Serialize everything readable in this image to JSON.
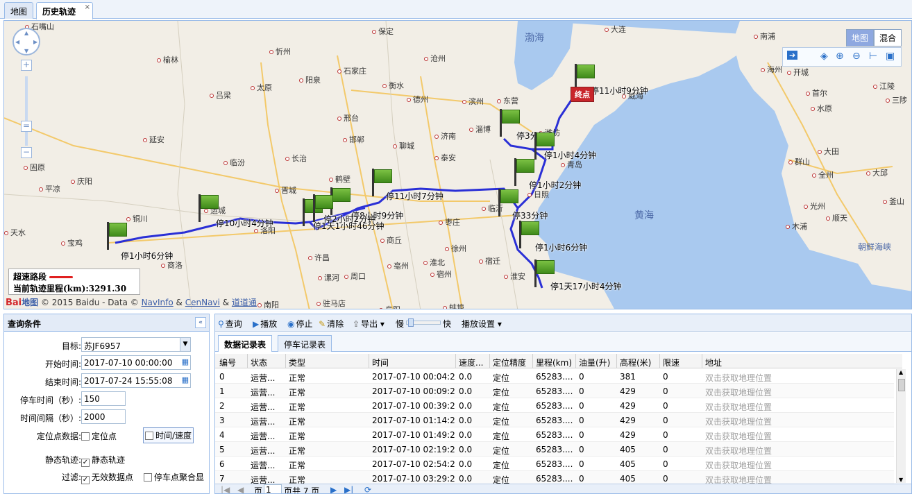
{
  "tabs": [
    {
      "label": "地图"
    },
    {
      "label": "历史轨迹"
    }
  ],
  "tab_close": "×",
  "map": {
    "type_buttons": {
      "map": "地图",
      "hybrid": "混合"
    },
    "legend": {
      "overspeed": "超速路段",
      "mileage": "当前轨迹里程(km):3291.30"
    },
    "copyright": {
      "logo": "Bai",
      "logo2": "地图",
      "text": "© 2015 Baidu - Data ©",
      "navinfo": "NavInfo",
      "amp": "&",
      "cennavi": "CenNavi",
      "amp2": "&",
      "daodao": "道道通"
    },
    "sea_labels": [
      {
        "t": "渤海"
      },
      {
        "t": "黄海"
      },
      {
        "t": "朝鲜海峡"
      }
    ],
    "cities": [
      "石嘴山",
      "忻州",
      "保定",
      "大连",
      "南浦",
      "榆林",
      "太原",
      "石家庄",
      "沧州",
      "海州",
      "开城",
      "江陵",
      "吕梁",
      "阳泉",
      "衡水",
      "德州",
      "东营",
      "首尔",
      "三陟",
      "邢台",
      "滨州",
      "淄博",
      "威海",
      "水原",
      "延安",
      "邯郸",
      "济南",
      "聊城",
      "潍坊",
      "大田",
      "临汾",
      "长治",
      "泰安",
      "青岛",
      "群山",
      "全州",
      "大邱",
      "庆阳",
      "固原",
      "平凉",
      "晋城",
      "鹤壁",
      "日照",
      "光州",
      "顺天",
      "釜山",
      "铜川",
      "运城",
      "临沂",
      "木浦",
      "天水",
      "宝鸡",
      "洛阳",
      "枣庄",
      "商丘",
      "徐州",
      "宿迁",
      "商洛",
      "许昌",
      "淮北",
      "漯河",
      "周口",
      "宿州",
      "亳州",
      "淮安",
      "驻马店",
      "阜阳",
      "蚌埠",
      "南阳"
    ],
    "end_marker": "终点",
    "stops": [
      "停11小时9分钟",
      "停3分钟",
      "停1小时4分钟",
      "停1小时2分钟",
      "停11小时7分钟",
      "停33分钟",
      "停1小时6分钟",
      "停1天17小时4分钟",
      "停10小时4分钟",
      "停1小时6分钟",
      "停8小时9分钟",
      "停1天1小时46分钟",
      "停2小时2分钟"
    ]
  },
  "query": {
    "title": "查询条件",
    "target_label": "目标:",
    "target_value": "苏JF6957",
    "start_label": "开始时间:",
    "start_value": "2017-07-10 00:00:00",
    "end_label": "结束时间:",
    "end_value": "2017-07-24 15:55:08",
    "stop_label": "停车时间（秒）:",
    "stop_value": "150",
    "interval_label": "时间间隔（秒）:",
    "interval_value": "2000",
    "locdata_label": "定位点数据:",
    "locpoint": "定位点",
    "timespeed": "时间/速度",
    "static_label": "静态轨迹:",
    "static_check": "静态轨迹",
    "filter_label": "过滤:",
    "invalid": "无效数据点",
    "merge": "停车点聚合显"
  },
  "toolbar": {
    "query": "查询",
    "play": "播放",
    "stop": "停止",
    "clear": "清除",
    "export": "导出",
    "slow": "慢",
    "fast": "快",
    "settings": "播放设置"
  },
  "grid": {
    "tabs": [
      "数据记录表",
      "停车记录表"
    ],
    "headers": [
      "编号",
      "状态",
      "类型",
      "时间",
      "速度...",
      "定位精度",
      "里程(km)",
      "油量(升)",
      "高程(米)",
      "限速",
      "地址"
    ],
    "rows": [
      [
        "0",
        "运营...",
        "正常",
        "2017-07-10 00:04:29",
        "0.0",
        "定位",
        "65283....",
        "0",
        "381",
        "0",
        "双击获取地理位置"
      ],
      [
        "1",
        "运营...",
        "正常",
        "2017-07-10 00:09:29",
        "0.0",
        "定位",
        "65283....",
        "0",
        "429",
        "0",
        "双击获取地理位置"
      ],
      [
        "2",
        "运营...",
        "正常",
        "2017-07-10 00:39:29",
        "0.0",
        "定位",
        "65283....",
        "0",
        "429",
        "0",
        "双击获取地理位置"
      ],
      [
        "3",
        "运营...",
        "正常",
        "2017-07-10 01:14:29",
        "0.0",
        "定位",
        "65283....",
        "0",
        "429",
        "0",
        "双击获取地理位置"
      ],
      [
        "4",
        "运营...",
        "正常",
        "2017-07-10 01:49:29",
        "0.0",
        "定位",
        "65283....",
        "0",
        "429",
        "0",
        "双击获取地理位置"
      ],
      [
        "5",
        "运营...",
        "正常",
        "2017-07-10 02:19:29",
        "0.0",
        "定位",
        "65283....",
        "0",
        "405",
        "0",
        "双击获取地理位置"
      ],
      [
        "6",
        "运营...",
        "正常",
        "2017-07-10 02:54:29",
        "0.0",
        "定位",
        "65283....",
        "0",
        "405",
        "0",
        "双击获取地理位置"
      ],
      [
        "7",
        "运营...",
        "正常",
        "2017-07-10 03:29:29",
        "0.0",
        "定位",
        "65283....",
        "0",
        "405",
        "0",
        "双击获取地理位置"
      ]
    ]
  },
  "pager": {
    "page_pre": "页",
    "page_value": "1",
    "page_post": "页共 7 页"
  },
  "colors": {
    "route": "#2a2fd6",
    "flag": "#4a9a1e",
    "end": "#c8252a",
    "accent": "#99bbe8"
  }
}
